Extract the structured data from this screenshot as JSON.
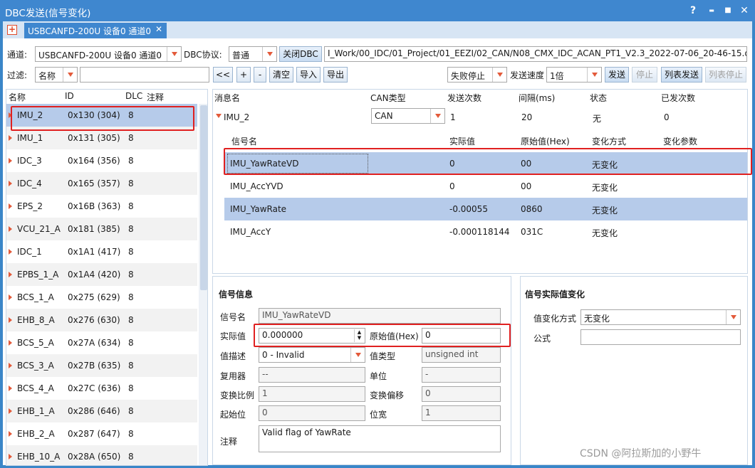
{
  "window": {
    "title": "DBC发送(信号变化)",
    "help": "?",
    "minimize": "▬",
    "maximize": "■",
    "close": "✕"
  },
  "tab": {
    "label": "USBCANFD-200U 设备0 通道0",
    "close": "✕",
    "new": "+"
  },
  "toolbar1": {
    "channel_label": "通道:",
    "channel_value": "USBCANFD-200U 设备0 通道0",
    "dbc_label": "DBC协议:",
    "dbc_value": "普通",
    "close_dbc": "关闭DBC",
    "dbc_path": "I_Work/00_IDC/01_Project/01_EEZI/02_CAN/N08_CMX_IDC_ACAN_PT1_V2.3_2022-07-06_20-46-15.dbc"
  },
  "toolbar2": {
    "filter_label": "过滤:",
    "filter_value": "名称",
    "filter_text": "",
    "prev": "<<",
    "add": "+",
    "remove": "-",
    "clear": "清空",
    "import": "导入",
    "export": "导出",
    "fail_value": "失败停止",
    "speed_label": "发送速度",
    "speed_value": "1倍",
    "send": "发送",
    "stop": "停止",
    "list_send": "列表发送",
    "list_stop": "列表停止"
  },
  "left_list": {
    "headers": {
      "name": "名称",
      "id": "ID",
      "dlc": "DLC",
      "note": "注释"
    },
    "rows": [
      {
        "name": "IMU_2",
        "id": "0x130 (304)",
        "dlc": "8"
      },
      {
        "name": "IMU_1",
        "id": "0x131 (305)",
        "dlc": "8"
      },
      {
        "name": "IDC_3",
        "id": "0x164 (356)",
        "dlc": "8"
      },
      {
        "name": "IDC_4",
        "id": "0x165 (357)",
        "dlc": "8"
      },
      {
        "name": "EPS_2",
        "id": "0x16B (363)",
        "dlc": "8"
      },
      {
        "name": "VCU_21_A",
        "id": "0x181 (385)",
        "dlc": "8"
      },
      {
        "name": "IDC_1",
        "id": "0x1A1 (417)",
        "dlc": "8"
      },
      {
        "name": "EPBS_1_A",
        "id": "0x1A4 (420)",
        "dlc": "8"
      },
      {
        "name": "BCS_1_A",
        "id": "0x275 (629)",
        "dlc": "8"
      },
      {
        "name": "EHB_8_A",
        "id": "0x276 (630)",
        "dlc": "8"
      },
      {
        "name": "BCS_5_A",
        "id": "0x27A (634)",
        "dlc": "8"
      },
      {
        "name": "BCS_3_A",
        "id": "0x27B (635)",
        "dlc": "8"
      },
      {
        "name": "BCS_4_A",
        "id": "0x27C (636)",
        "dlc": "8"
      },
      {
        "name": "EHB_1_A",
        "id": "0x286 (646)",
        "dlc": "8"
      },
      {
        "name": "EHB_2_A",
        "id": "0x287 (647)",
        "dlc": "8"
      },
      {
        "name": "EHB_10_A",
        "id": "0x28A (650)",
        "dlc": "8"
      }
    ]
  },
  "message_table": {
    "headers": {
      "name": "消息名",
      "can_type": "CAN类型",
      "send_count": "发送次数",
      "interval": "间隔(ms)",
      "status": "状态",
      "sent": "已发次数"
    },
    "row": {
      "name": "IMU_2",
      "can_type": "CAN",
      "send_count": "1",
      "interval": "20",
      "status": "无",
      "sent": "0"
    },
    "signal_headers": {
      "name": "信号名",
      "actual": "实际值",
      "raw": "原始值(Hex)",
      "mode": "变化方式",
      "param": "变化参数"
    },
    "signals": [
      {
        "name": "IMU_YawRateVD",
        "actual": "0",
        "raw": "00",
        "mode": "无变化"
      },
      {
        "name": "IMU_AccYVD",
        "actual": "0",
        "raw": "00",
        "mode": "无变化"
      },
      {
        "name": "IMU_YawRate",
        "actual": "-0.00055",
        "raw": "0860",
        "mode": "无变化"
      },
      {
        "name": "IMU_AccY",
        "actual": "-0.000118144",
        "raw": "031C",
        "mode": "无变化"
      }
    ]
  },
  "signal_info": {
    "title": "信号信息",
    "name_label": "信号名",
    "name_value": "IMU_YawRateVD",
    "actual_label": "实际值",
    "actual_value": "0.000000",
    "raw_label": "原始值(Hex)",
    "raw_value": "0",
    "desc_label": "值描述",
    "desc_value": "0 - Invalid",
    "type_label": "值类型",
    "type_value": "unsigned int",
    "mux_label": "复用器",
    "mux_value": "--",
    "unit_label": "单位",
    "unit_value": "-",
    "scale_label": "变换比例",
    "scale_value": "1",
    "offset_label": "变换偏移",
    "offset_value": "0",
    "start_label": "起始位",
    "start_value": "0",
    "width_label": "位宽",
    "width_value": "1",
    "note_label": "注释",
    "note_value": "Valid flag of YawRate"
  },
  "value_change": {
    "title": "信号实际值变化",
    "mode_label": "值变化方式",
    "mode_value": "无变化",
    "formula_label": "公式",
    "formula_value": ""
  },
  "watermark": "CSDN @阿拉斯加的小野牛",
  "colors": {
    "titlebar": "#3f87cf",
    "selection": "#b6cbea",
    "highlight": "#e02020",
    "arrow": "#e35a3a"
  }
}
